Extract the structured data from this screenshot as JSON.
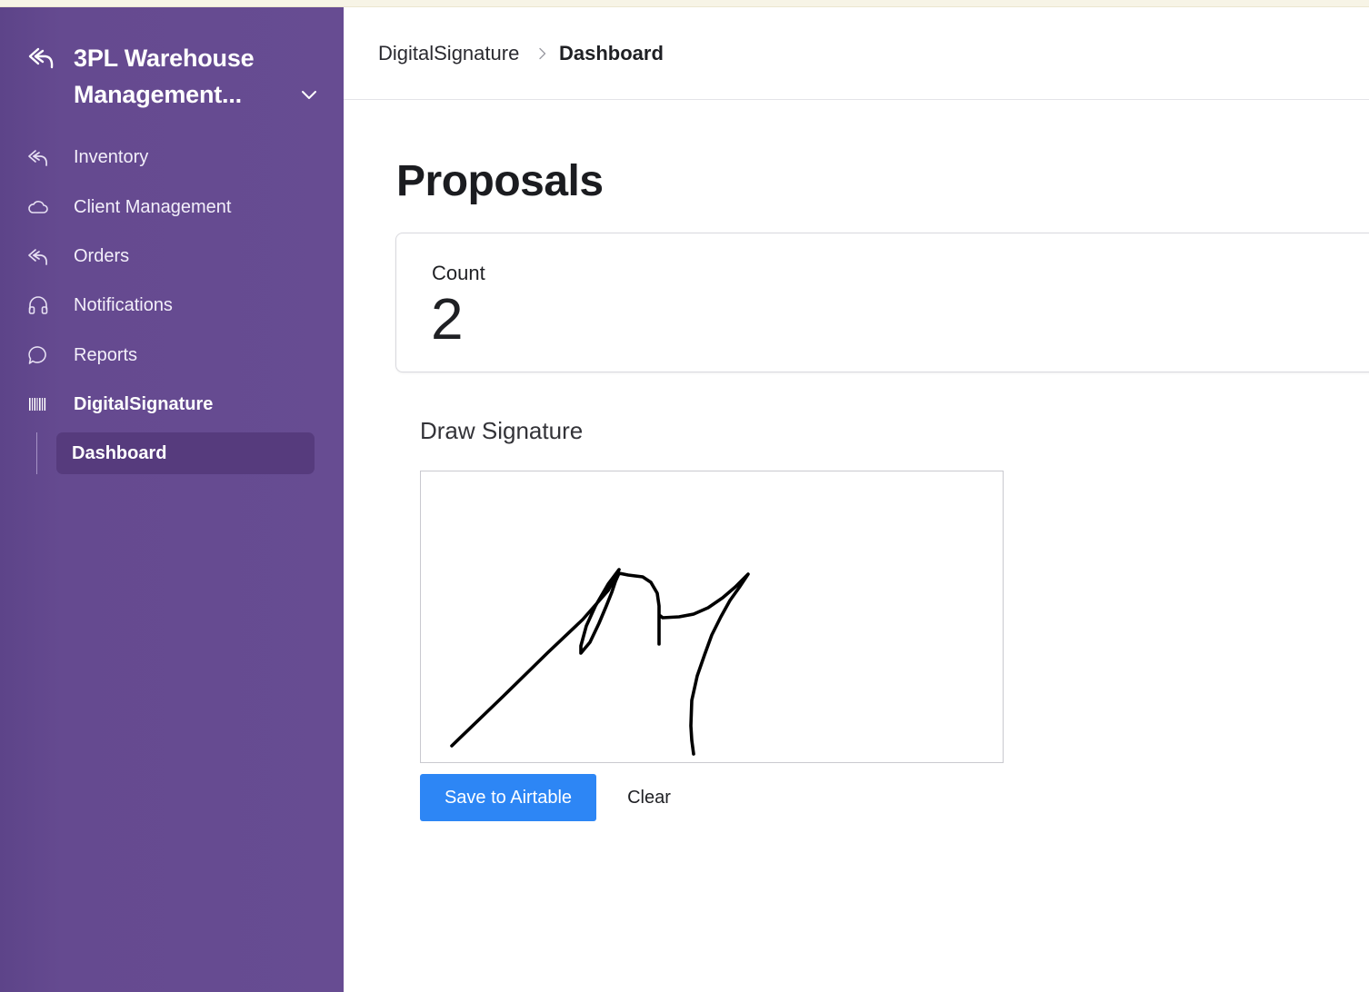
{
  "app": {
    "title": "3PL Warehouse Management...",
    "logo_icon": "reply-arrow-icon"
  },
  "sidebar": {
    "items": [
      {
        "label": "Inventory",
        "icon": "reply-arrow-icon"
      },
      {
        "label": "Client Management",
        "icon": "cloud-icon"
      },
      {
        "label": "Orders",
        "icon": "reply-arrow-icon"
      },
      {
        "label": "Notifications",
        "icon": "headphones-icon"
      },
      {
        "label": "Reports",
        "icon": "chat-bubble-icon"
      },
      {
        "label": "DigitalSignature",
        "icon": "barcode-icon",
        "active": true
      }
    ],
    "sub_items": [
      {
        "label": "Dashboard",
        "active": true
      }
    ]
  },
  "breadcrumb": {
    "parent": "DigitalSignature",
    "current": "Dashboard"
  },
  "main": {
    "title": "Proposals",
    "count_card": {
      "label": "Count",
      "value": "2"
    },
    "signature": {
      "heading": "Draw Signature",
      "save_label": "Save to Airtable",
      "clear_label": "Clear"
    }
  },
  "colors": {
    "sidebar_bg": "#674c92",
    "active_sub_bg": "#563b7d",
    "primary_button": "#2d86f5"
  }
}
